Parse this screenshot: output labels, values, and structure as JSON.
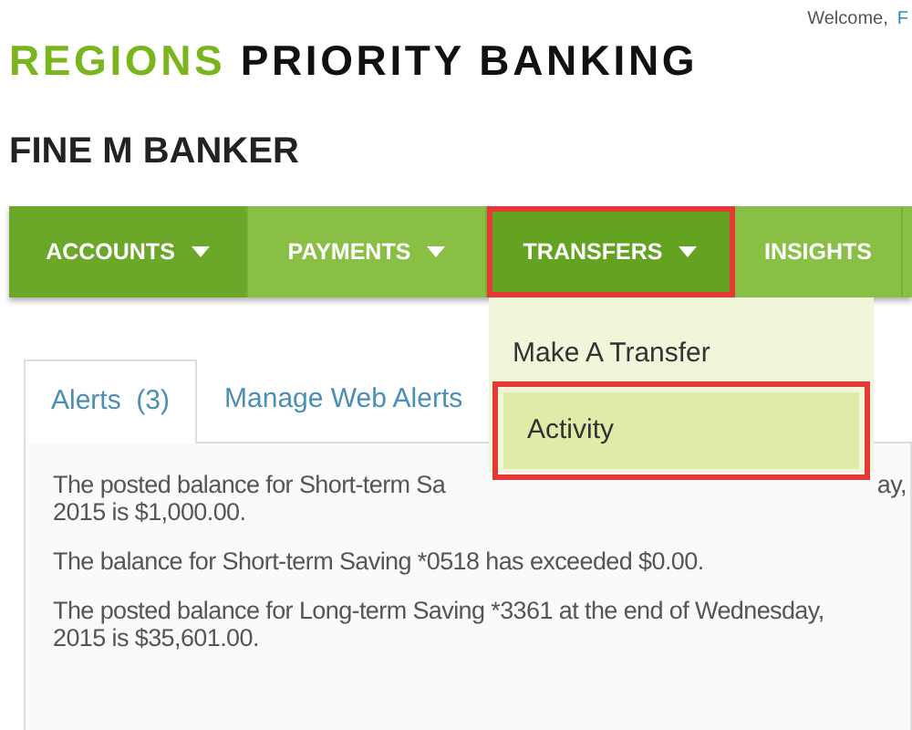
{
  "header": {
    "welcome": "Welcome,",
    "user_name": "F",
    "logo": {
      "brand": "REGIONS",
      "product": "PRIORITY BANKING"
    }
  },
  "client_name": "FINE M BANKER",
  "nav": [
    {
      "label": "ACCOUNTS",
      "has_menu": true,
      "selected": false,
      "current": true,
      "highlighted": false
    },
    {
      "label": "PAYMENTS",
      "has_menu": true,
      "selected": false,
      "highlighted": false
    },
    {
      "label": "TRANSFERS",
      "has_menu": true,
      "selected": true,
      "highlighted": true
    },
    {
      "label": "INSIGHTS",
      "has_menu": false,
      "selected": false,
      "highlighted": false
    }
  ],
  "dropdown": [
    {
      "label": "Make A Transfer",
      "selected": false,
      "highlighted": false
    },
    {
      "label": "Activity",
      "selected": true,
      "highlighted": true
    }
  ],
  "tabs": [
    {
      "label": "Alerts  (3)",
      "selected": true
    },
    {
      "label": "Manage Web Alerts",
      "selected": false
    }
  ],
  "alerts": [
    {
      "line_start": "The posted balance for Short-term Sa",
      "line_end": "ay,",
      "line_2": "2015 is $1,000.00."
    },
    {
      "line_start": "The balance for Short-term Saving *0518 has exceeded $0.00."
    },
    {
      "line_start": "The posted balance for Long-term Saving *3361 at the end of Wednesday,",
      "line_2": "2015 is $35,601.00."
    }
  ]
}
